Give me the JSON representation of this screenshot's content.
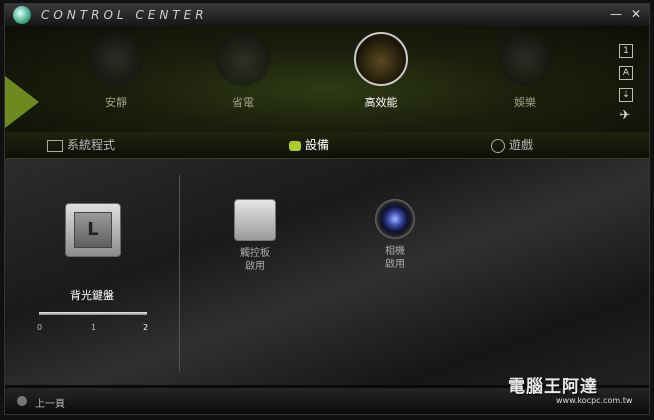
{
  "app": {
    "title": "CONTROL CENTER"
  },
  "window_buttons": {
    "minimize": "—",
    "close": "✕"
  },
  "modes": [
    {
      "label": "安靜",
      "icon": "speaker-icon",
      "active": false
    },
    {
      "label": "省電",
      "icon": "fan-icon",
      "active": false
    },
    {
      "label": "高效能",
      "icon": "speedometer-icon",
      "active": true
    },
    {
      "label": "娛樂",
      "icon": "target-icon",
      "active": false
    }
  ],
  "side_buttons": [
    "1",
    "A",
    "⇣",
    "✈"
  ],
  "tabs": [
    {
      "label": "系統程式",
      "icon": "monitor-icon"
    },
    {
      "label": "設備",
      "icon": "plug-icon"
    },
    {
      "label": "遊戲",
      "icon": "gamepad-icon"
    }
  ],
  "keyboard": {
    "key_char": "L",
    "label": "背光鍵盤",
    "ticks": [
      "0",
      "1",
      "2"
    ],
    "value": 2
  },
  "devices": [
    {
      "name": "觸控板",
      "state": "啟用",
      "icon": "touchpad-icon"
    },
    {
      "name": "相機",
      "state": "啟用",
      "icon": "camera-icon"
    }
  ],
  "status": {
    "back_label": "上一頁"
  },
  "watermark": {
    "text": "電腦王阿達",
    "url": "www.kocpc.com.tw"
  }
}
